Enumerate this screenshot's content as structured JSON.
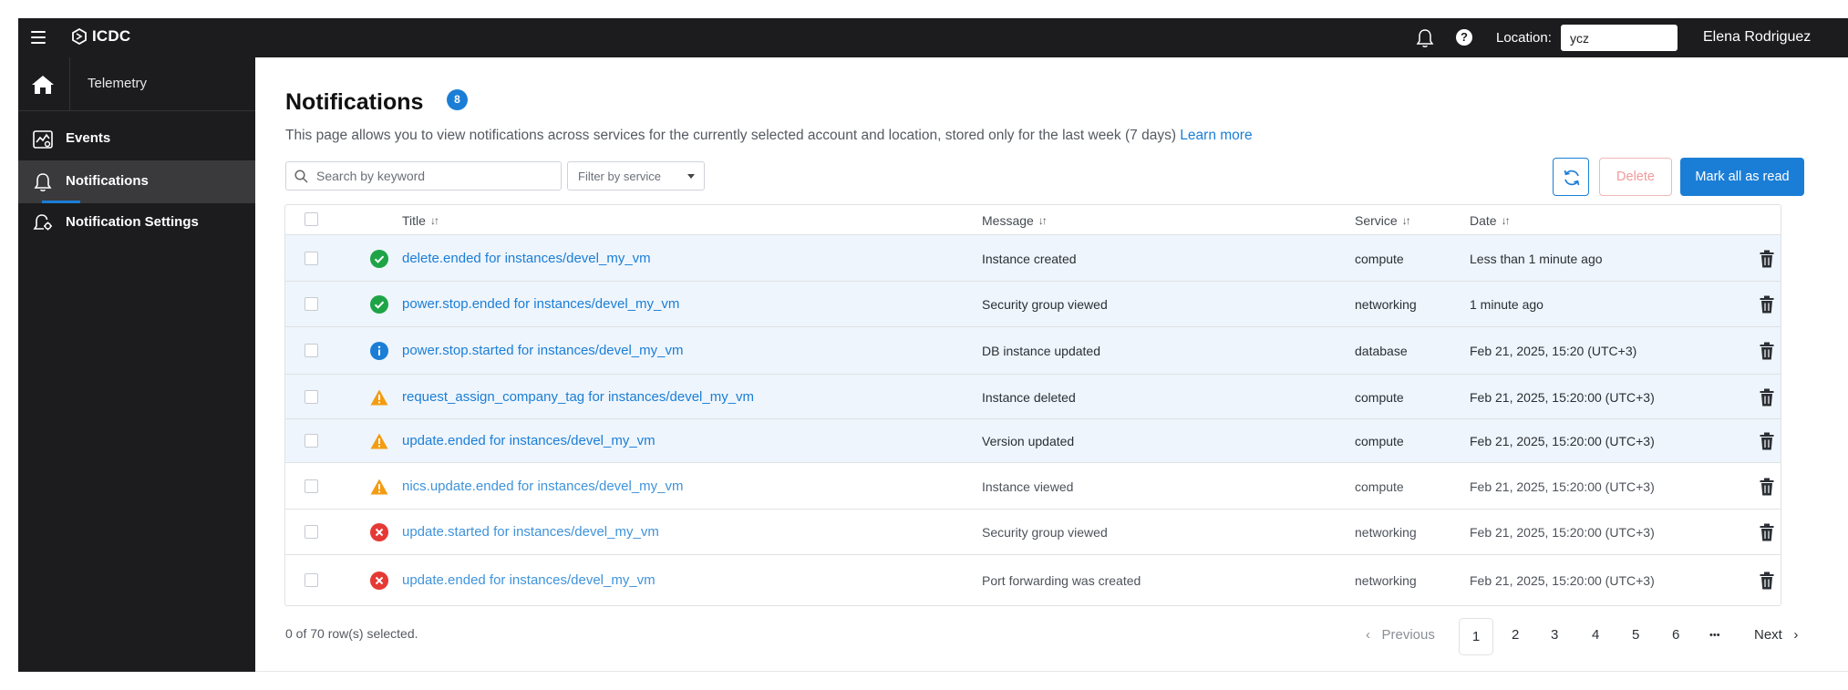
{
  "app": {
    "name": "ICDC"
  },
  "topbar": {
    "location_label": "Location:",
    "location_value": "ycz",
    "user_name": "Elena Rodriguez"
  },
  "sidebar": {
    "section_title": "Telemetry",
    "items": [
      {
        "label": "Events",
        "icon": "events-chart-icon",
        "active": false
      },
      {
        "label": "Notifications",
        "icon": "bell-icon",
        "active": true
      },
      {
        "label": "Notification Settings",
        "icon": "bell-settings-icon",
        "active": false
      }
    ]
  },
  "page": {
    "title": "Notifications",
    "count": "8",
    "description": "This page allows you to view notifications across services for the currently selected account and location, stored only for the last week (7 days)",
    "learn_more": "Learn more"
  },
  "toolbar": {
    "search_placeholder": "Search by keyword",
    "filter_placeholder": "Filter by service",
    "delete_label": "Delete",
    "mark_all_label": "Mark all as read"
  },
  "table": {
    "headers": {
      "title": "Title",
      "message": "Message",
      "service": "Service",
      "date": "Date"
    },
    "rows": [
      {
        "status": "success",
        "title": "delete.ended for instances/devel_my_vm",
        "message": "Instance created",
        "service": "compute",
        "date": "Less than 1 minute ago",
        "unread": true
      },
      {
        "status": "success",
        "title": "power.stop.ended for instances/devel_my_vm",
        "message": "Security group viewed",
        "service": "networking",
        "date": "1 minute ago",
        "unread": true
      },
      {
        "status": "info",
        "title": "power.stop.started for instances/devel_my_vm",
        "message": "DB instance updated",
        "service": "database",
        "date": "Feb 21, 2025, 15:20 (UTC+3)",
        "unread": true
      },
      {
        "status": "warning",
        "title": "request_assign_company_tag for instances/devel_my_vm",
        "message": "Instance deleted",
        "service": "compute",
        "date": "Feb 21, 2025, 15:20:00 (UTC+3)",
        "unread": true
      },
      {
        "status": "warning",
        "title": "update.ended for instances/devel_my_vm",
        "message": "Version updated",
        "service": "compute",
        "date": "Feb 21, 2025, 15:20:00 (UTC+3)",
        "unread": true
      },
      {
        "status": "warning",
        "title": "nics.update.ended for instances/devel_my_vm",
        "message": "Instance viewed",
        "service": "compute",
        "date": "Feb 21, 2025, 15:20:00 (UTC+3)",
        "unread": false
      },
      {
        "status": "error",
        "title": "update.started for instances/devel_my_vm",
        "message": "Security group viewed",
        "service": "networking",
        "date": "Feb 21, 2025, 15:20:00 (UTC+3)",
        "unread": false
      },
      {
        "status": "error",
        "title": "update.ended for instances/devel_my_vm",
        "message": "Port forwarding was created",
        "service": "networking",
        "date": "Feb 21, 2025, 15:20:00 (UTC+3)",
        "unread": false
      }
    ]
  },
  "footer": {
    "rows_selected": "0 of 70 row(s) selected.",
    "pagination": {
      "previous": "Previous",
      "next": "Next",
      "current": "1",
      "pages": [
        "2",
        "3",
        "4",
        "5",
        "6"
      ],
      "ellipsis": "•••"
    }
  },
  "colors": {
    "accent": "#1b7ed6",
    "success": "#1ea446",
    "warning": "#f39c12",
    "error": "#e53935",
    "unread_row": "#eef5fc",
    "chrome": "#1c1c1e"
  }
}
